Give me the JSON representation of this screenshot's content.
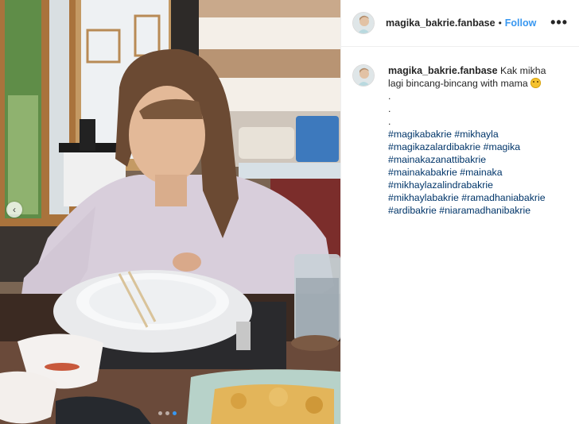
{
  "post": {
    "username": "magika_bakrie.fanbase",
    "separator": "•",
    "follow_label": "Follow",
    "more_label": "•••"
  },
  "caption": {
    "username": "magika_bakrie.fanbase",
    "text_line1": "Kak mikha",
    "text_line2": "lagi bincang-bincang with mama",
    "emoji": "smiling-face-emoji",
    "dot1": ".",
    "dot2": ".",
    "dot3": ".",
    "hashtag_lines": [
      "#magikabakrie #mikhayla",
      "#magikazalardibakrie #magika",
      "#mainakazanattibakrie",
      "#mainakabakrie #mainaka",
      "#mikhaylazalindrabakrie",
      "#mikhaylabakrie #ramadhaniabakrie",
      "#ardibakrie #niaramadhanibakrie"
    ]
  },
  "media": {
    "prev_arrow": "‹",
    "carousel_count": 3,
    "carousel_active": 3
  },
  "colors": {
    "link": "#3897f0",
    "hashtag": "#003569",
    "text": "#262626"
  }
}
